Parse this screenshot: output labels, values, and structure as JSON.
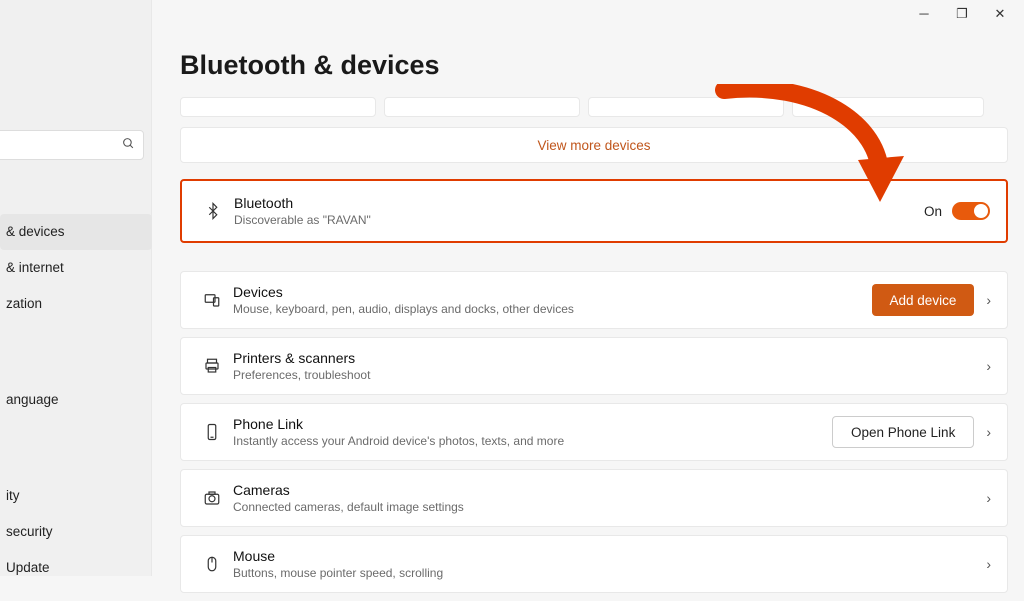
{
  "page": {
    "title": "Bluetooth & devices"
  },
  "viewMore": "View more devices",
  "sidebar": {
    "items": [
      {
        "label": "& devices"
      },
      {
        "label": "& internet"
      },
      {
        "label": "zation"
      },
      {
        "label": "anguage"
      },
      {
        "label": "ity"
      },
      {
        "label": " security"
      },
      {
        "label": " Update"
      }
    ]
  },
  "bluetooth": {
    "title": "Bluetooth",
    "sub": "Discoverable as \"RAVAN\"",
    "stateLabel": "On"
  },
  "cards": {
    "devices": {
      "title": "Devices",
      "sub": "Mouse, keyboard, pen, audio, displays and docks, other devices",
      "button": "Add device"
    },
    "printers": {
      "title": "Printers & scanners",
      "sub": "Preferences, troubleshoot"
    },
    "phonelink": {
      "title": "Phone Link",
      "sub": "Instantly access your Android device's photos, texts, and more",
      "button": "Open Phone Link"
    },
    "cameras": {
      "title": "Cameras",
      "sub": "Connected cameras, default image settings"
    },
    "mouse": {
      "title": "Mouse",
      "sub": "Buttons, mouse pointer speed, scrolling"
    }
  }
}
